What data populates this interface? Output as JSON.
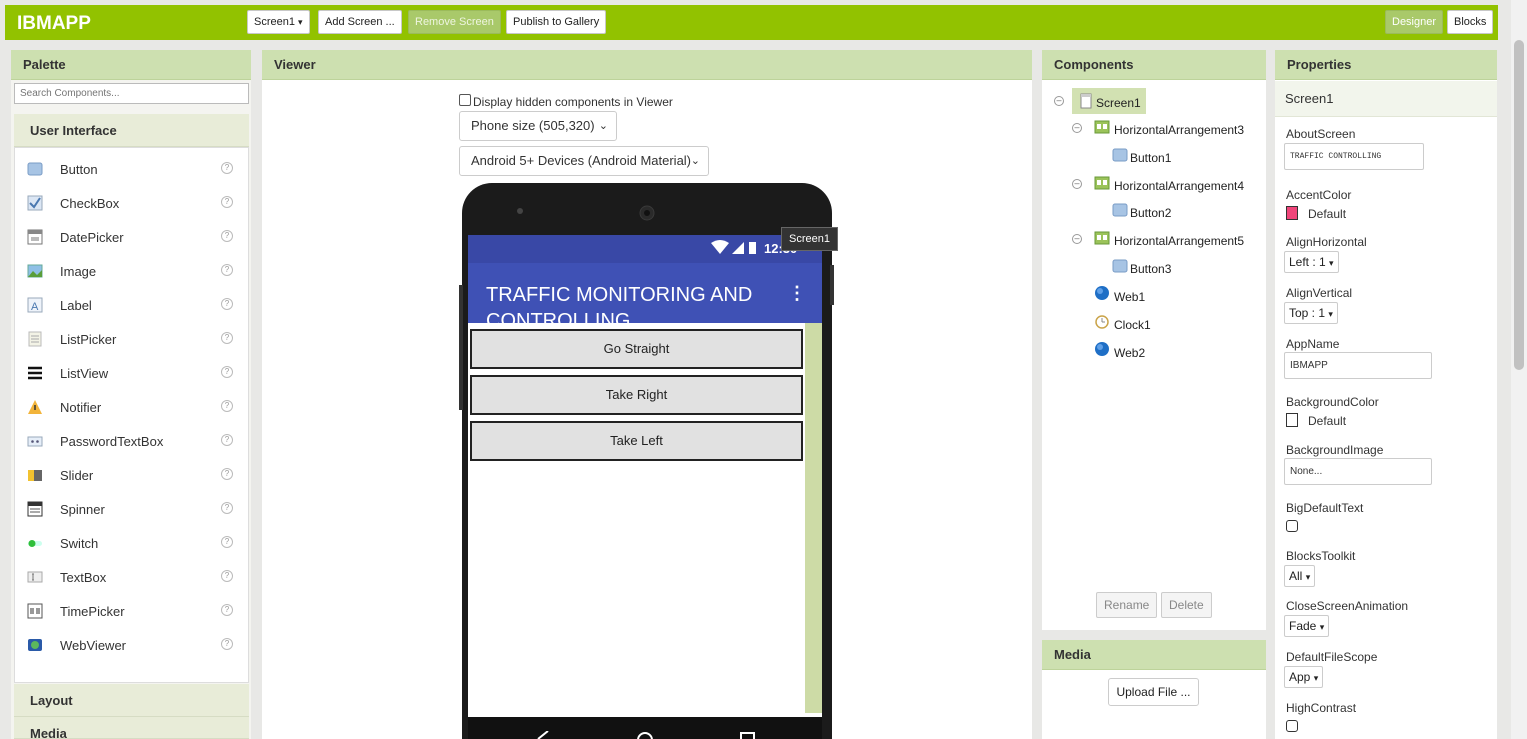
{
  "app": {
    "title": "IBMAPP"
  },
  "toolbar": {
    "screen_select": "Screen1",
    "add_screen": "Add Screen ...",
    "remove_screen": "Remove Screen",
    "publish": "Publish to Gallery",
    "designer": "Designer",
    "blocks": "Blocks"
  },
  "palette": {
    "title": "Palette",
    "search_placeholder": "Search Components...",
    "category_ui": "User Interface",
    "items": [
      {
        "label": "Button",
        "icon": "button-icon"
      },
      {
        "label": "CheckBox",
        "icon": "checkbox-icon"
      },
      {
        "label": "DatePicker",
        "icon": "datepicker-icon"
      },
      {
        "label": "Image",
        "icon": "image-icon"
      },
      {
        "label": "Label",
        "icon": "label-icon"
      },
      {
        "label": "ListPicker",
        "icon": "listpicker-icon"
      },
      {
        "label": "ListView",
        "icon": "listview-icon"
      },
      {
        "label": "Notifier",
        "icon": "notifier-icon"
      },
      {
        "label": "PasswordTextBox",
        "icon": "password-icon"
      },
      {
        "label": "Slider",
        "icon": "slider-icon"
      },
      {
        "label": "Spinner",
        "icon": "spinner-icon"
      },
      {
        "label": "Switch",
        "icon": "switch-icon"
      },
      {
        "label": "TextBox",
        "icon": "textbox-icon"
      },
      {
        "label": "TimePicker",
        "icon": "timepicker-icon"
      },
      {
        "label": "WebViewer",
        "icon": "webviewer-icon"
      }
    ],
    "help_glyph": "?",
    "category_layout": "Layout",
    "category_media": "Media"
  },
  "viewer": {
    "title": "Viewer",
    "hidden_components_label": "Display hidden components in Viewer",
    "phone_size": "Phone size (505,320)",
    "theme": "Android 5+ Devices (Android Material)",
    "status_time": "12:30",
    "app_title": "TRAFFIC MONITORING AND CONTROLLING",
    "menu_glyph": "⋮",
    "buttons": [
      "Go Straight",
      "Take Right",
      "Take Left"
    ],
    "tooltip": "Screen1"
  },
  "components": {
    "title": "Components",
    "tree": [
      {
        "label": "Screen1",
        "level": 0
      },
      {
        "label": "HorizontalArrangement3",
        "level": 1
      },
      {
        "label": "Button1",
        "level": 2
      },
      {
        "label": "HorizontalArrangement4",
        "level": 1
      },
      {
        "label": "Button2",
        "level": 2
      },
      {
        "label": "HorizontalArrangement5",
        "level": 1
      },
      {
        "label": "Button3",
        "level": 2
      },
      {
        "label": "Web1",
        "level": 1
      },
      {
        "label": "Clock1",
        "level": 1
      },
      {
        "label": "Web2",
        "level": 1
      }
    ],
    "rename": "Rename",
    "delete": "Delete"
  },
  "media": {
    "title": "Media",
    "upload": "Upload File ..."
  },
  "properties": {
    "title": "Properties",
    "screen": "Screen1",
    "about_label": "AboutScreen",
    "about_value": "TRAFFIC CONTROLLING",
    "accent_label": "AccentColor",
    "accent_value": "Default",
    "accent_color": "#f0457a",
    "align_h_label": "AlignHorizontal",
    "align_h_value": "Left : 1",
    "align_v_label": "AlignVertical",
    "align_v_value": "Top : 1",
    "appname_label": "AppName",
    "appname_value": "IBMAPP",
    "bgcolor_label": "BackgroundColor",
    "bgcolor_value": "Default",
    "bgimage_label": "BackgroundImage",
    "bgimage_value": "None...",
    "bigtext_label": "BigDefaultText",
    "toolkit_label": "BlocksToolkit",
    "toolkit_value": "All",
    "close_anim_label": "CloseScreenAnimation",
    "close_anim_value": "Fade",
    "filescope_label": "DefaultFileScope",
    "filescope_value": "App",
    "contrast_label": "HighContrast",
    "dropdown_glyph": "▾"
  }
}
